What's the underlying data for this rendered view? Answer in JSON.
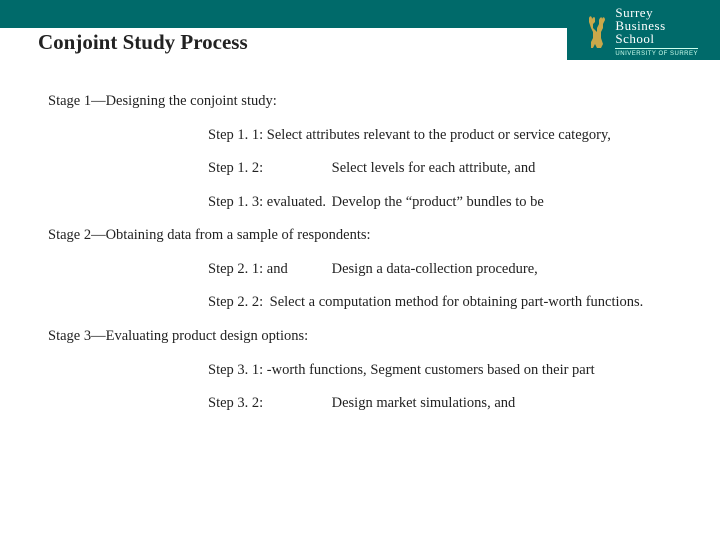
{
  "header": {
    "title": "Conjoint Study Process",
    "brand_line1": "Surrey",
    "brand_line2": "Business",
    "brand_line3": "School",
    "brand_sub": "UNIVERSITY OF SURREY"
  },
  "stages": {
    "s1": {
      "heading": "Stage 1—Designing the conjoint study:",
      "step11": "Step 1. 1: Select attributes relevant to the product or service category,",
      "step12_label": "Step 1. 2:",
      "step12_text": "Select levels for each attribute, and",
      "step13_label": "Step 1. 3: evaluated.",
      "step13_text": "Develop the “product” bundles to be"
    },
    "s2": {
      "heading": "Stage 2—Obtaining data from a sample of respondents:",
      "step21_label": "Step 2. 1: and",
      "step21_text": "Design a data-collection procedure,",
      "step22_label": "Step 2. 2:",
      "step22_text": "Select a computation method for obtaining part-worth functions."
    },
    "s3": {
      "heading": "Stage 3—Evaluating product design options:",
      "step31_label": "Step 3. 1: -worth functions,",
      "step31_text": "Segment customers based on their part",
      "step32_label": "Step 3. 2:",
      "step32_text": "Design market simulations, and"
    }
  }
}
